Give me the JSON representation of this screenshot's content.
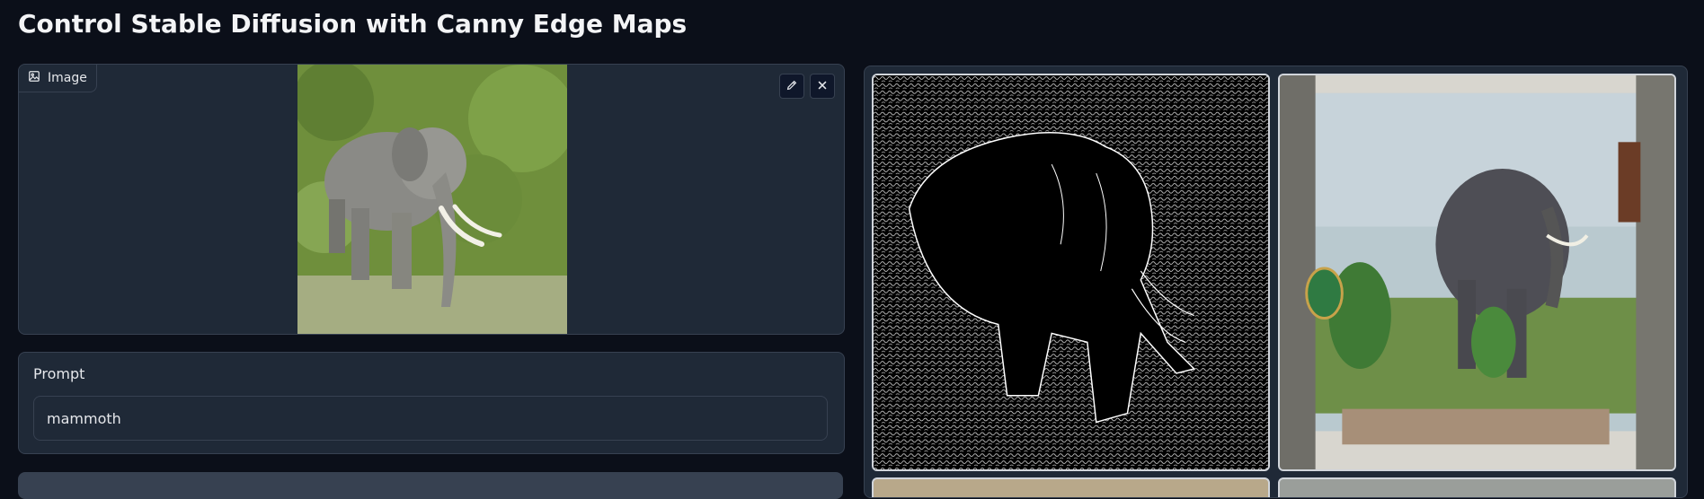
{
  "page": {
    "title": "Control Stable Diffusion with Canny Edge Maps"
  },
  "image_input": {
    "label": "Image",
    "label_icon": "image-icon",
    "edit_icon": "pencil-icon",
    "clear_icon": "close-icon"
  },
  "prompt": {
    "label": "Prompt",
    "value": "mammoth"
  },
  "gallery": {
    "items": [
      {
        "kind": "canny-edge-map"
      },
      {
        "kind": "generated-mammoth"
      },
      {
        "kind": "partial"
      },
      {
        "kind": "partial"
      }
    ]
  },
  "colors": {
    "background": "#0b0f19",
    "panel": "#1f2937",
    "border": "#374151",
    "text": "#e5e7eb"
  }
}
